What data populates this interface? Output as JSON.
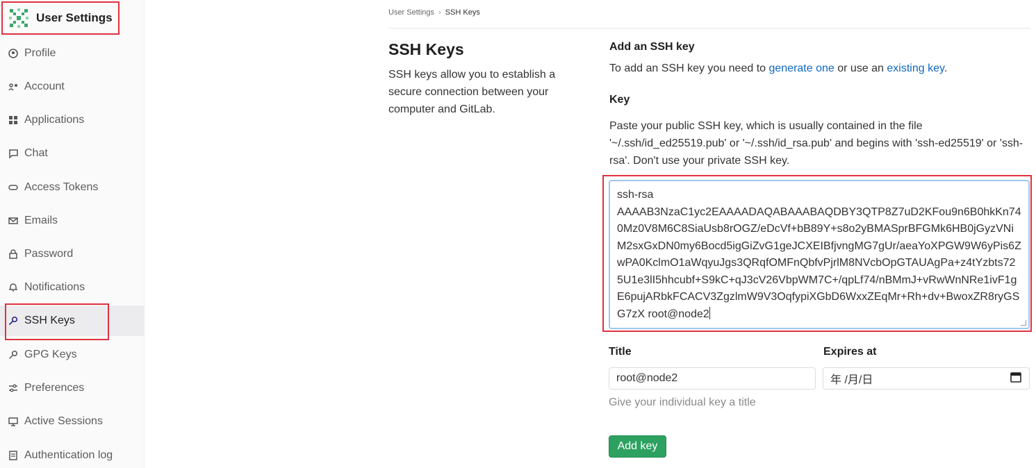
{
  "sidebar": {
    "title": "User Settings",
    "items": [
      {
        "label": "Profile",
        "icon": "profile-icon"
      },
      {
        "label": "Account",
        "icon": "account-icon"
      },
      {
        "label": "Applications",
        "icon": "applications-icon"
      },
      {
        "label": "Chat",
        "icon": "chat-icon"
      },
      {
        "label": "Access Tokens",
        "icon": "token-icon"
      },
      {
        "label": "Emails",
        "icon": "mail-icon"
      },
      {
        "label": "Password",
        "icon": "lock-icon"
      },
      {
        "label": "Notifications",
        "icon": "bell-icon"
      },
      {
        "label": "SSH Keys",
        "icon": "key-icon"
      },
      {
        "label": "GPG Keys",
        "icon": "key-icon"
      },
      {
        "label": "Preferences",
        "icon": "preferences-icon"
      },
      {
        "label": "Active Sessions",
        "icon": "monitor-icon"
      },
      {
        "label": "Authentication log",
        "icon": "log-icon"
      }
    ]
  },
  "breadcrumb": {
    "parent": "User Settings",
    "current": "SSH Keys"
  },
  "section": {
    "title": "SSH Keys",
    "description": "SSH keys allow you to establish a secure connection between your computer and GitLab."
  },
  "form": {
    "add_heading": "Add an SSH key",
    "intro_prefix": "To add an SSH key you need to ",
    "intro_link1": "generate one",
    "intro_middle": " or use an ",
    "intro_link2": "existing key",
    "intro_suffix": ".",
    "key_label": "Key",
    "key_help": "Paste your public SSH key, which is usually contained in the file '~/.ssh/id_ed25519.pub' or '~/.ssh/id_rsa.pub' and begins with 'ssh-ed25519' or 'ssh-rsa'. Don't use your private SSH key.",
    "key_value_line1": "ssh-rsa",
    "key_value_rest": "AAAAB3NzaC1yc2EAAAADAQABAAABAQDBY3QTP8Z7uD2KFou9n6B0hkKn740Mz0V8M6C8SiaUsb8rOGZ/eDcVf+bB89Y+s8o2yBMASprBFGMk6HB0jGyzVNiM2sxGxDN0my6Bocd5igGiZvG1geJCXEIBfjvngMG7gUr/aeaYoXPGW9W6yPis6ZwPA0KclmO1aWqyuJgs3QRqfOMFnQbfvPjrlM8NVcbOpGTAUAgPa+z4tYzbts725U1e3lI5hhcubf+S9kC+qJ3cV26VbpWM7C+/qpLf74/nBMmJ+vRwWnNRe1ivF1gE6pujARbkFCACV3ZgzlmW9V3OqfypiXGbD6WxxZEqMr+Rh+dv+BwoxZR8ryGSG7zX root@node2",
    "title_label": "Title",
    "title_value": "root@node2",
    "title_hint": "Give your individual key a title",
    "expires_label": "Expires at",
    "expires_value": "年 /月/日",
    "submit_label": "Add key"
  },
  "colors": {
    "accent_red": "#e0313f",
    "link": "#1068bf",
    "button_green": "#2da160"
  }
}
